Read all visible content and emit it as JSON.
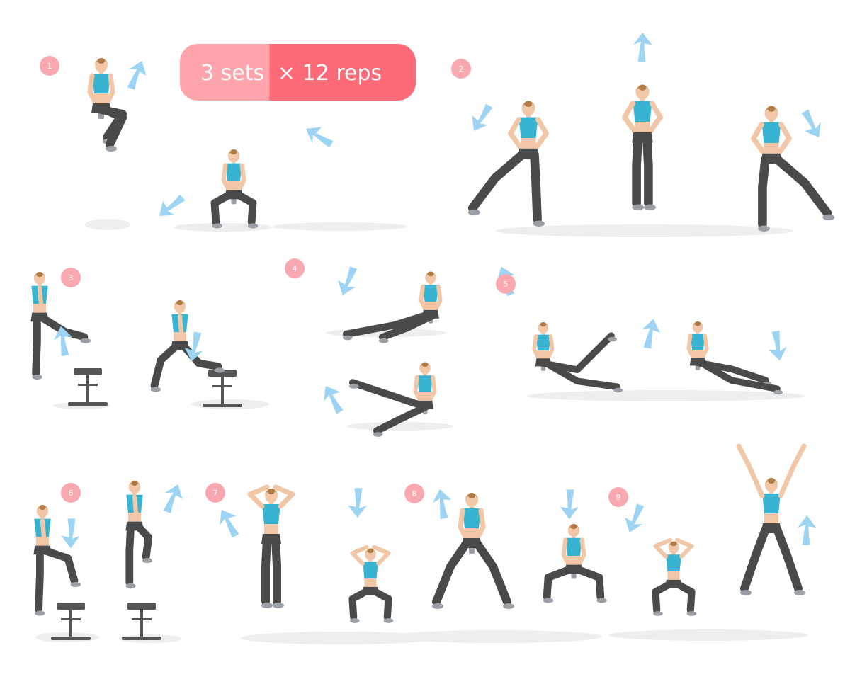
{
  "header": {
    "sets_label": "3 sets",
    "reps_label": "× 12 reps"
  },
  "steps": [
    "1",
    "2",
    "3",
    "4",
    "5",
    "6",
    "7",
    "8",
    "9"
  ],
  "colors": {
    "pill_left": "#fda4ad",
    "pill_right": "#fd6b78",
    "badge": "#f9a7b0",
    "top": "#38b3d1",
    "skin": "#f2c7a8",
    "hair": "#b07a44",
    "leggings": "#4a4a4a",
    "shoe": "#9aa0a6",
    "arrow": "#9dd3f3",
    "shadow": "#eeeeee",
    "bench": "#555555"
  },
  "icons": [
    "exercise-figure-icon",
    "direction-arrow-icon",
    "step-bench-icon",
    "dumbbell-icon"
  ]
}
